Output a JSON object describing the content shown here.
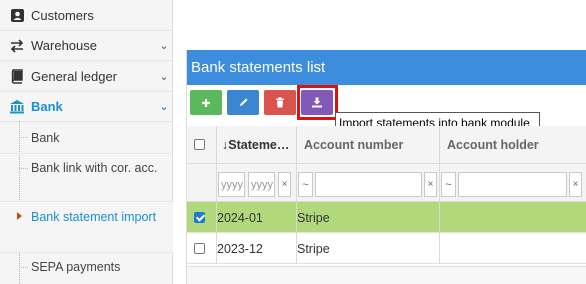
{
  "sidebar": {
    "items": [
      {
        "label": "Customers",
        "icon": "customers-icon"
      },
      {
        "label": "Warehouse",
        "icon": "arrows-icon"
      },
      {
        "label": "General ledger",
        "icon": "book-icon"
      },
      {
        "label": "Bank",
        "icon": "bank-icon"
      }
    ],
    "sub_items": [
      {
        "label": "Bank"
      },
      {
        "label": "Bank link with cor. acc."
      },
      {
        "label": "Bank statement import"
      },
      {
        "label": "SEPA payments"
      }
    ]
  },
  "panel": {
    "title": "Bank statements list",
    "tooltip": "Import statements into bank module"
  },
  "grid": {
    "columns": [
      "↓Stateme…",
      "Account number",
      "Account holder"
    ],
    "filters": {
      "date_from_placeholder": "yyyy",
      "date_to_placeholder": "yyyy",
      "operator": "~",
      "clear": "×"
    },
    "rows": [
      {
        "statement": "2024-01",
        "account_number": "Stripe",
        "account_holder": "",
        "selected": true
      },
      {
        "statement": "2023-12",
        "account_number": "Stripe",
        "account_holder": "",
        "selected": false
      }
    ]
  },
  "colors": {
    "accent": "#1a8fd1",
    "header": "#3c8dde",
    "selected_row": "#b1d97c",
    "add": "#5cb85c",
    "edit": "#3b86d1",
    "delete": "#d9534f",
    "import": "#8259b8",
    "highlight": "#e01010"
  }
}
